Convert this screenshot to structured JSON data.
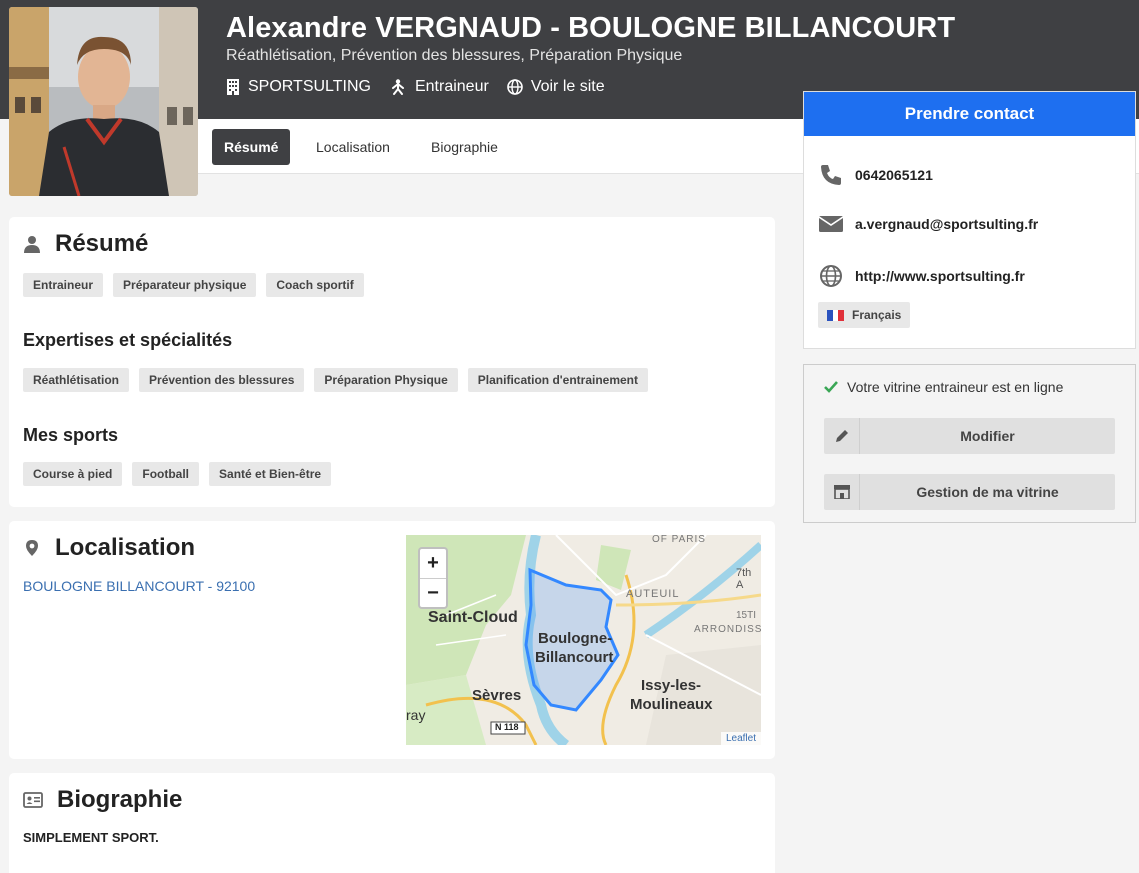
{
  "header": {
    "name": "Alexandre VERGNAUD - BOULOGNE BILLANCOURT",
    "subtitle": "Réathlétisation, Prévention des blessures, Préparation Physique",
    "company": "SPORTSULTING",
    "role": "Entraineur",
    "site_link": "Voir le site"
  },
  "tabs": [
    {
      "label": "Résumé",
      "active": true
    },
    {
      "label": "Localisation",
      "active": false
    },
    {
      "label": "Biographie",
      "active": false
    }
  ],
  "resume": {
    "title": "Résumé",
    "tags": [
      "Entraineur",
      "Préparateur physique",
      "Coach sportif"
    ],
    "expertises_title": "Expertises et spécialités",
    "expertises": [
      "Réathlétisation",
      "Prévention des blessures",
      "Préparation Physique",
      "Planification d'entrainement"
    ],
    "sports_title": "Mes sports",
    "sports": [
      "Course à pied",
      "Football",
      "Santé et Bien-être"
    ]
  },
  "localisation": {
    "title": "Localisation",
    "address": "BOULOGNE BILLANCOURT - 92100",
    "map": {
      "zoom_in": "+",
      "zoom_out": "−",
      "attribution": "Leaflet",
      "labels": {
        "paris": "OF PARIS",
        "seventh": "7th A",
        "auteuil": "AUTEUIL",
        "fifteenth": "15TI",
        "arrond": "ARRONDISS",
        "saint_cloud": "Saint-Cloud",
        "boulogne1": "Boulogne-",
        "boulogne2": "Billancourt",
        "issy1": "Issy-les-",
        "issy2": "Moulineaux",
        "sevres": "Sèvres",
        "ray": "ray",
        "road": "N 118"
      }
    }
  },
  "biographie": {
    "title": "Biographie",
    "text": "SIMPLEMENT SPORT."
  },
  "contact": {
    "title": "Prendre contact",
    "phone": "0642065121",
    "email": "a.vergnaud@sportsulting.fr",
    "website": "http://www.sportsulting.fr",
    "language": "Français"
  },
  "status": {
    "online_text": "Votre vitrine entraineur est en ligne",
    "edit_label": "Modifier",
    "manage_label": "Gestion de ma vitrine"
  },
  "colors": {
    "header_bg": "#3f4043",
    "accent_blue": "#1e6ff0",
    "link_blue": "#3a6fb0",
    "online_green": "#3aa655"
  }
}
